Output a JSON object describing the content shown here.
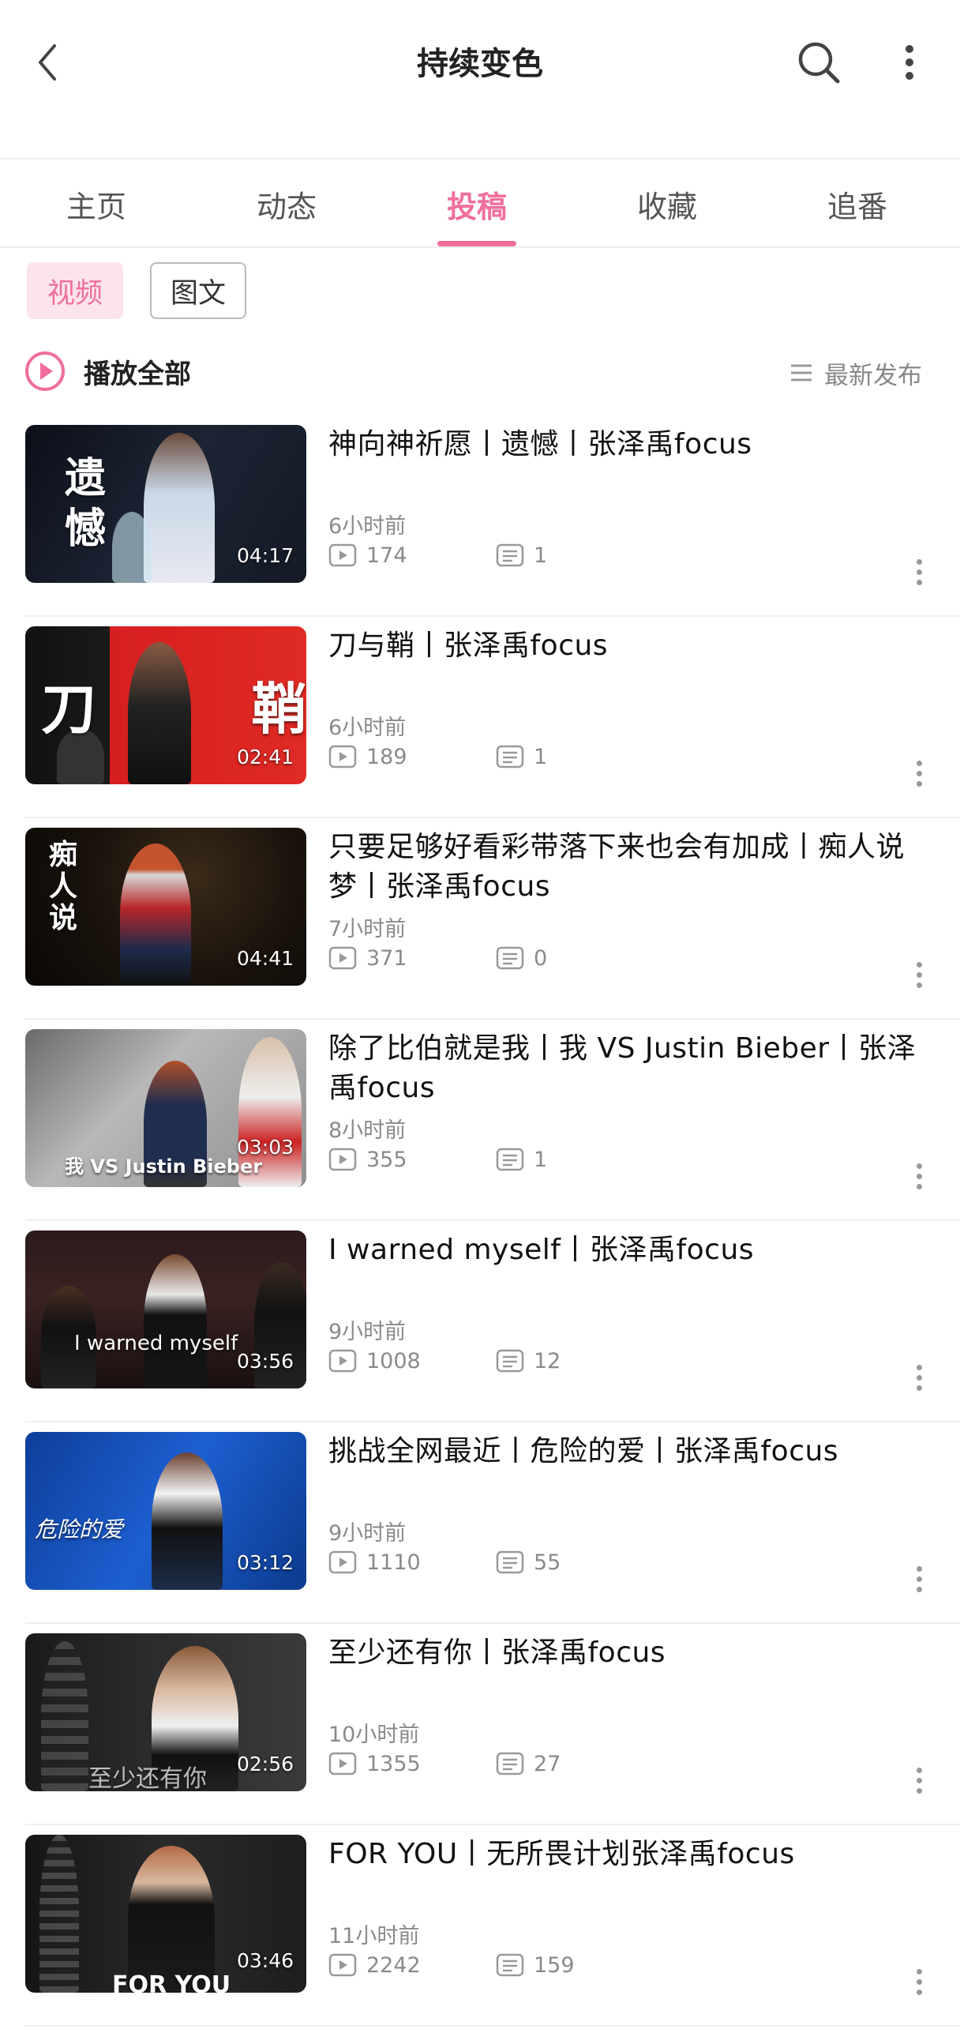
{
  "header": {
    "title": "持续变色",
    "back_icon": "chevron-left-icon",
    "search_icon": "search-icon",
    "more_icon": "more-vertical-icon"
  },
  "tabs": [
    {
      "label": "主页",
      "active": false
    },
    {
      "label": "动态",
      "active": false
    },
    {
      "label": "投稿",
      "active": true
    },
    {
      "label": "收藏",
      "active": false
    },
    {
      "label": "追番",
      "active": false
    }
  ],
  "filters": {
    "video_label": "视频",
    "article_label": "图文"
  },
  "play_all": {
    "label": "播放全部",
    "icon": "play-circle-icon"
  },
  "sort": {
    "label": "最新发布",
    "icon": "list-icon"
  },
  "colors": {
    "accent": "#f06e9d",
    "accent_bg": "#fde3ec",
    "muted": "#8a8a8a"
  },
  "videos": [
    {
      "title": "神向神祈愿丨遗憾丨张泽禹focus",
      "time": "6小时前",
      "views": "174",
      "comments": "1",
      "duration": "04:17",
      "thumb_text": "遗憾"
    },
    {
      "title": "刀与鞘丨张泽禹focus",
      "time": "6小时前",
      "views": "189",
      "comments": "1",
      "duration": "02:41",
      "thumb_text": "刀 鞘"
    },
    {
      "title": "只要足够好看彩带落下来也会有加成丨痴人说梦丨张泽禹focus",
      "time": "7小时前",
      "views": "371",
      "comments": "0",
      "duration": "04:41",
      "thumb_text": "痴人说"
    },
    {
      "title": "除了比伯就是我丨我 VS Justin Bieber丨张泽禹focus",
      "time": "8小时前",
      "views": "355",
      "comments": "1",
      "duration": "03:03",
      "thumb_text": "我 VS Justin Bieber"
    },
    {
      "title": "I warned myself丨张泽禹focus",
      "time": "9小时前",
      "views": "1008",
      "comments": "12",
      "duration": "03:56",
      "thumb_text": "I warned myself"
    },
    {
      "title": "挑战全网最近丨危险的爱丨张泽禹focus",
      "time": "9小时前",
      "views": "1110",
      "comments": "55",
      "duration": "03:12",
      "thumb_text": "危险的爱"
    },
    {
      "title": "至少还有你丨张泽禹focus",
      "time": "10小时前",
      "views": "1355",
      "comments": "27",
      "duration": "02:56",
      "thumb_text": "至少还有你"
    },
    {
      "title": "FOR YOU丨无所畏计划张泽禹focus",
      "time": "11小时前",
      "views": "2242",
      "comments": "159",
      "duration": "03:46",
      "thumb_text": "FOR YOU"
    }
  ]
}
